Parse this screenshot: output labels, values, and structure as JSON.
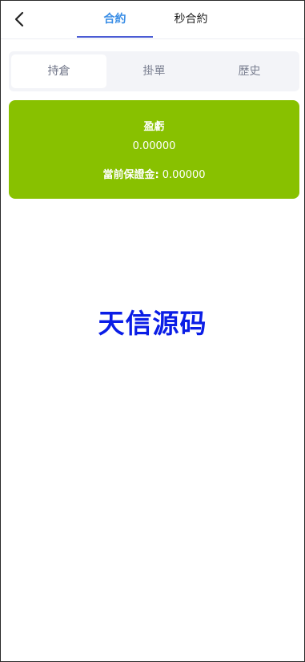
{
  "header": {
    "back_icon": "chevron-left-icon",
    "tabs": [
      {
        "label": "合約",
        "active": true
      },
      {
        "label": "秒合約",
        "active": false
      }
    ]
  },
  "segment": {
    "items": [
      {
        "label": "持倉",
        "active": true
      },
      {
        "label": "掛單",
        "active": false
      },
      {
        "label": "歷史",
        "active": false
      }
    ]
  },
  "pnl_card": {
    "label": "盈虧",
    "value": "0.00000",
    "margin_label": "當前保證金:",
    "margin_value": "0.00000"
  },
  "watermark": {
    "text": "天信源码"
  },
  "colors": {
    "accent": "#3a8ee6",
    "tab_underline": "#4a5bd4",
    "card_green": "#88c100",
    "watermark_blue": "#0a1de6",
    "segment_bg": "#f3f4f8"
  }
}
